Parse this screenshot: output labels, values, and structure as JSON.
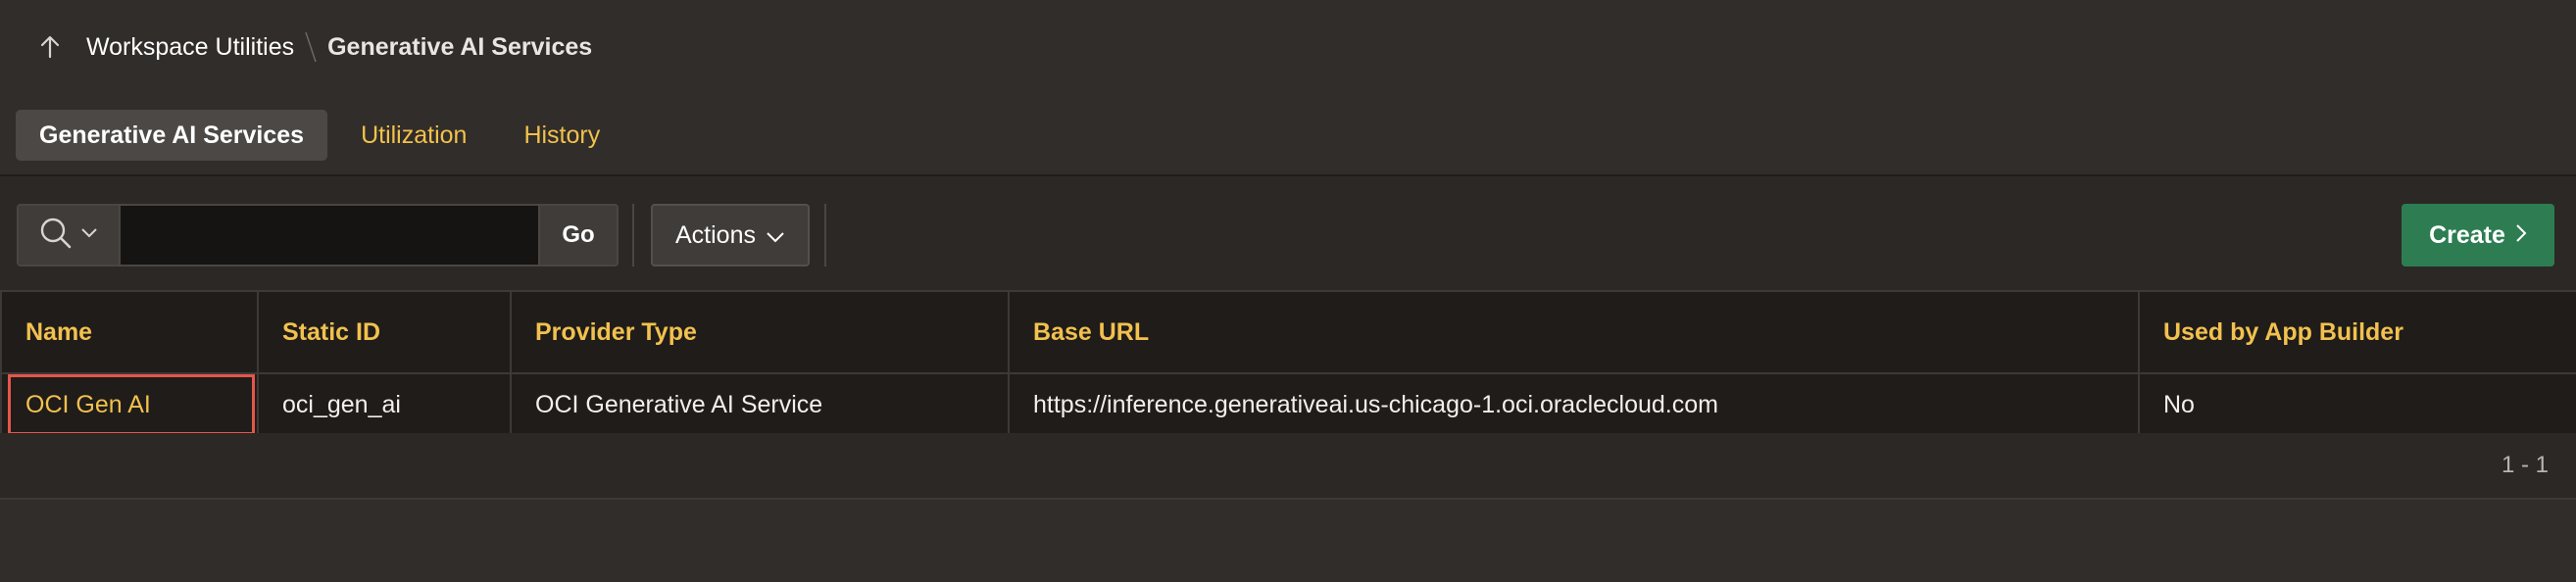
{
  "breadcrumb": {
    "parent": "Workspace Utilities",
    "current": "Generative AI Services"
  },
  "tabs": [
    {
      "label": "Generative AI Services",
      "active": true
    },
    {
      "label": "Utilization",
      "active": false
    },
    {
      "label": "History",
      "active": false
    }
  ],
  "toolbar": {
    "search_value": "",
    "go_label": "Go",
    "actions_label": "Actions",
    "create_label": "Create"
  },
  "table": {
    "columns": [
      "Name",
      "Static ID",
      "Provider Type",
      "Base URL",
      "Used by App Builder"
    ],
    "rows": [
      {
        "name": "OCI Gen AI",
        "static_id": "oci_gen_ai",
        "provider_type": "OCI Generative AI Service",
        "base_url": "https://inference.generativeai.us-chicago-1.oci.oraclecloud.com",
        "used_by_app_builder": "No"
      }
    ]
  },
  "pagination": "1 - 1",
  "colors": {
    "background": "#312d2a",
    "link": "#f2c14e",
    "create_button": "#2e7d52",
    "highlight_border": "#e5564a"
  },
  "icons": {
    "up": "arrow-up-icon",
    "search": "search-icon",
    "dropdown": "chevron-down-icon",
    "create": "chevron-right-icon"
  }
}
